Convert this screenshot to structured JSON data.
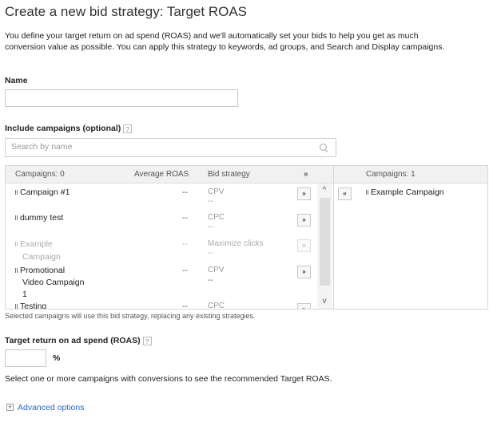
{
  "page_title": "Create a new bid strategy: Target ROAS",
  "description": [
    "You define your target return on ad spend (ROAS) and we'll automatically set your bids to help you get as much",
    "conversion value as possible. You can apply this strategy to keywords, ad groups, and Search and Display campaigns."
  ],
  "name_field": {
    "label": "Name",
    "value": ""
  },
  "include_campaigns": {
    "label": "Include campaigns (optional)",
    "help": "?",
    "search_placeholder": "Search by name",
    "left_header": {
      "campaigns": "Campaigns: 0",
      "avg_roas": "Average ROAS",
      "bid_strategy": "Bid strategy",
      "add_all": "»"
    },
    "rows": [
      {
        "name": [
          "Campaign #1"
        ],
        "roas": "--",
        "strategy": [
          "CPV",
          "--"
        ],
        "add": "»",
        "disabled": false
      },
      {
        "name": [
          "dummy test"
        ],
        "roas": "--",
        "strategy": [
          "CPC",
          "--"
        ],
        "add": "»",
        "disabled": false
      },
      {
        "name": [
          "Example",
          "Campaign"
        ],
        "roas": "--",
        "strategy": [
          "Maximize clicks",
          "--"
        ],
        "add": "»",
        "disabled": true
      },
      {
        "name": [
          "Promotional",
          "Video Campaign",
          "1"
        ],
        "roas": "--",
        "strategy": [
          "CPV",
          "--"
        ],
        "add": "»",
        "disabled": false
      },
      {
        "name": [
          "Testing"
        ],
        "roas": "--",
        "strategy": [
          "CPC"
        ],
        "add": "»",
        "disabled": false
      }
    ],
    "right_header": {
      "campaigns": "Campaigns: 1"
    },
    "remove_all": "«",
    "selected": [
      "Example Campaign"
    ],
    "note": "Selected campaigns will use this bid strategy, replacing any existing strategies."
  },
  "target_roas": {
    "label": "Target return on ad spend (ROAS)",
    "help": "?",
    "value": "",
    "unit": "%",
    "note": "Select one or more campaigns with conversions to see the recommended Target ROAS."
  },
  "advanced_options": {
    "icon": "+",
    "label": "Advanced options"
  },
  "icons": {
    "search": "search-icon",
    "scroll_up": "^",
    "scroll_down": "v"
  }
}
